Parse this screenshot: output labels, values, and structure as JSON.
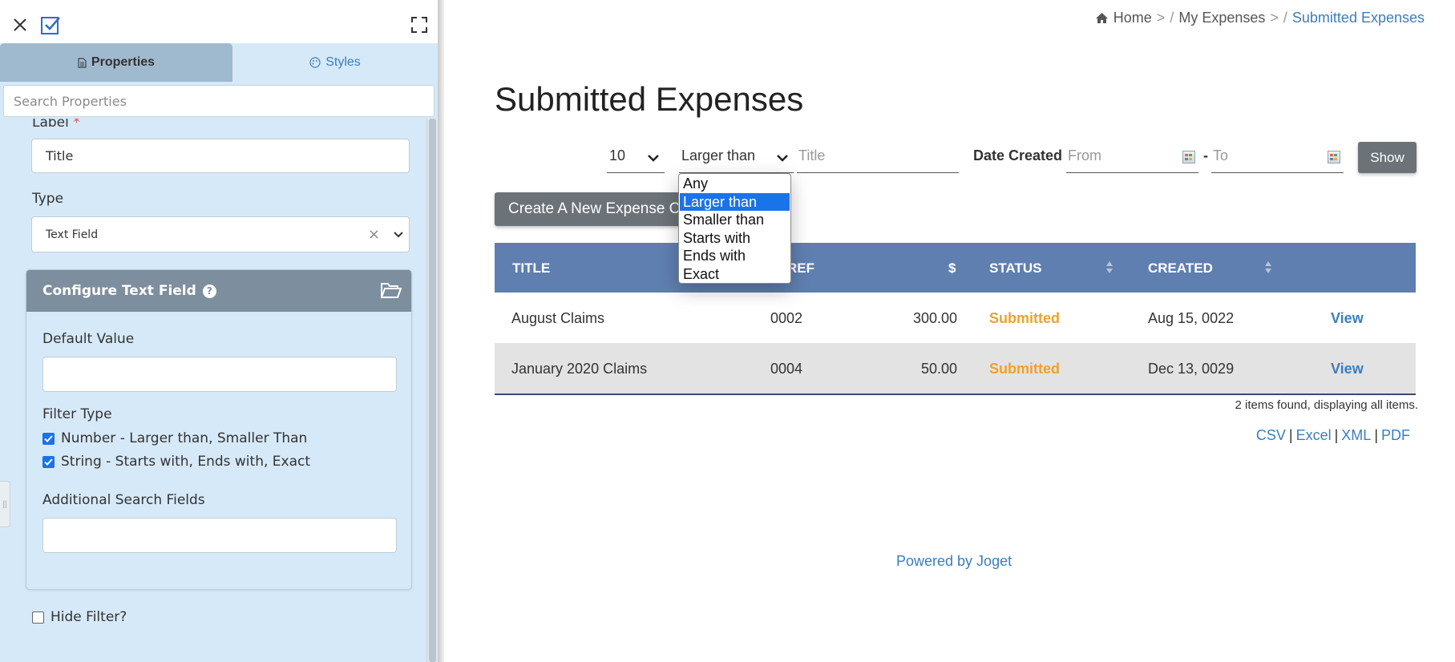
{
  "panel": {
    "tabs": [
      {
        "label": "Properties",
        "icon": "document-icon",
        "active": true
      },
      {
        "label": "Styles",
        "icon": "palette-icon",
        "active": false
      }
    ],
    "search_placeholder": "Search Properties",
    "label_field": {
      "label": "Label",
      "required_mark": "*",
      "value": "Title"
    },
    "type_field": {
      "label": "Type",
      "value": "Text Field",
      "clear": "×"
    },
    "config": {
      "title": "Configure Text Field",
      "help": "?",
      "default_value_label": "Default Value",
      "default_value": "",
      "filter_type_label": "Filter Type",
      "filter_options": [
        {
          "label": "Number - Larger than, Smaller Than",
          "checked": true
        },
        {
          "label": "String - Starts with, Ends with, Exact",
          "checked": true
        }
      ],
      "additional_label": "Additional Search Fields",
      "additional_value": ""
    },
    "hide_filter": {
      "label": "Hide Filter?",
      "checked": false
    }
  },
  "breadcrumb": [
    {
      "label": "Home",
      "icon": "home-icon"
    },
    {
      "label": "My Expenses"
    },
    {
      "label": "Submitted Expenses"
    }
  ],
  "breadcrumb_sep": "/",
  "breadcrumb_arrow": ">",
  "page_title": "Submitted Expenses",
  "filters": {
    "page_size": "10",
    "operator": "Larger than",
    "title_placeholder": "Title",
    "date_label": "Date Created",
    "from_placeholder": "From",
    "to_placeholder": "To",
    "dash": "-",
    "show_label": "Show"
  },
  "operator_options": [
    "Any",
    "Larger than",
    "Smaller than",
    "Starts with",
    "Ends with",
    "Exact"
  ],
  "create_label": "Create A New Expense Claim",
  "table": {
    "headers": [
      "TITLE",
      "REF",
      "$",
      "STATUS",
      "CREATED"
    ],
    "rows": [
      {
        "title": "August Claims",
        "ref": "0002",
        "amount": "300.00",
        "status": "Submitted",
        "created": "Aug 15, 0022",
        "action": "View"
      },
      {
        "title": "January 2020 Claims",
        "ref": "0004",
        "amount": "50.00",
        "status": "Submitted",
        "created": "Dec 13, 0029",
        "action": "View"
      }
    ]
  },
  "items_found": "2 items found, displaying all items.",
  "exports": [
    "CSV",
    "Excel",
    "XML",
    "PDF"
  ],
  "export_sep": "|",
  "powered_by": "Powered by Joget",
  "colors": {
    "accent": "#3a7ebf",
    "header_bg": "#5f7fb0",
    "status": "#f0a12a",
    "panel_bg": "#d6e9f8",
    "selected_option": "#1a73e8"
  }
}
